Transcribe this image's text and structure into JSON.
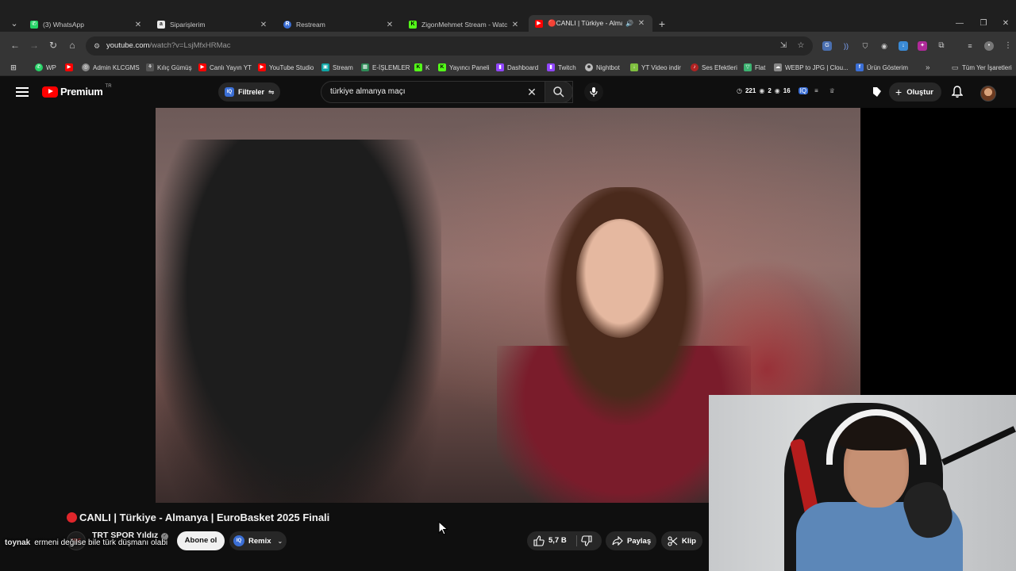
{
  "browser": {
    "tabs": [
      {
        "title": "(3) WhatsApp",
        "favicon_color": "#25d366",
        "active": false
      },
      {
        "title": "Siparişlerim",
        "favicon_color": "#e8e8e8",
        "active": false
      },
      {
        "title": "Restream",
        "favicon_color": "#3b6fd6",
        "active": false
      },
      {
        "title": "ZigonMehmet Stream - Watch",
        "favicon_color": "#53fc18",
        "active": false
      },
      {
        "title": "🔴CANLI | Türkiye - Alman",
        "favicon_color": "#ff0000",
        "active": true
      }
    ],
    "url_host": "youtube.com",
    "url_path": "/watch?v=LsjMfxHRMac",
    "bookmarks": [
      {
        "label": "WP",
        "color": "#25d366"
      },
      {
        "label": "",
        "color": "#ff0000"
      },
      {
        "label": "Admin KLCGMS",
        "color": "#888888"
      },
      {
        "label": "Kılıç Gümüş",
        "color": "#555555"
      },
      {
        "label": "Canlı Yayın YT",
        "color": "#ff0000"
      },
      {
        "label": "YouTube Studio",
        "color": "#ff0000"
      },
      {
        "label": "Stream",
        "color": "#0ea5a5"
      },
      {
        "label": "E-İŞLEMLER",
        "color": "#2e8b57"
      },
      {
        "label": "K",
        "color": "#53fc18"
      },
      {
        "label": "Yayıncı Paneli",
        "color": "#53fc18"
      },
      {
        "label": "Dashboard",
        "color": "#9146ff"
      },
      {
        "label": "Twitch",
        "color": "#9146ff"
      },
      {
        "label": "Nightbot",
        "color": "#bbbbbb"
      },
      {
        "label": "YT Video indir",
        "color": "#7fbf3f"
      },
      {
        "label": "Ses Efektleri",
        "color": "#b22222"
      },
      {
        "label": "Flat",
        "color": "#3cb371"
      },
      {
        "label": "WEBP to JPG | Clou...",
        "color": "#888888"
      },
      {
        "label": "Ürün Gösterim",
        "color": "#3b6fd6"
      },
      {
        "label": "Tüm Yer İşaretleri",
        "color": "#cccccc"
      }
    ]
  },
  "youtube": {
    "logo_text": "Premium",
    "country_code": "TR",
    "filters_label": "Filtreler",
    "search_query": "türkiye almanya maçı",
    "stats": {
      "a": "221",
      "b": "2",
      "c": "16"
    },
    "create_label": "Oluştur",
    "video": {
      "title": "CANLI | Türkiye - Almanya | EuroBasket 2025 Finali",
      "channel": "TRT SPOR Yıldız",
      "subscribers": "",
      "subscribe_label": "Abone ol",
      "remix_label": "Remix",
      "likes": "5,7 B",
      "share_label": "Paylaş",
      "clip_label": "Klip"
    }
  },
  "chat_overlay": {
    "user": "toynak",
    "message": "ermeni değilse bile türk düşmanı olabi"
  },
  "colors": {
    "accent_red": "#ff0000",
    "live_red": "#e0262b",
    "bg": "#0f0f0f"
  }
}
